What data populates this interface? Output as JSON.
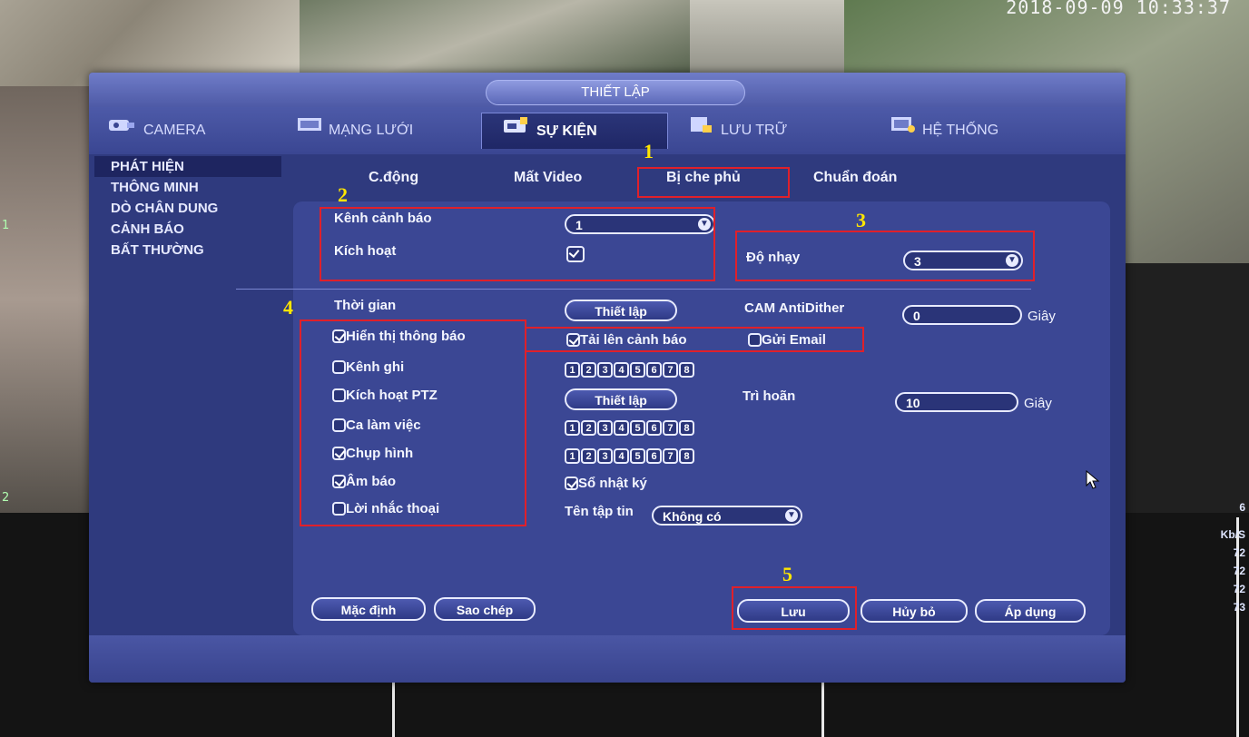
{
  "background": {
    "timestamp": "2018-09-09 10:33:37",
    "cam_labels": [
      "1",
      "2"
    ],
    "stats": [
      "6",
      "Kb/S",
      "72",
      "72",
      "72",
      "73"
    ]
  },
  "window": {
    "title": "THIẾT LẬP",
    "tabs": [
      {
        "label": "CAMERA",
        "icon": "camera-icon"
      },
      {
        "label": "MẠNG LƯỚI",
        "icon": "network-icon"
      },
      {
        "label": "SỰ KIỆN",
        "icon": "event-icon",
        "active": true
      },
      {
        "label": "LƯU TRỮ",
        "icon": "storage-icon"
      },
      {
        "label": "HỆ THỐNG",
        "icon": "system-icon"
      }
    ],
    "sidebar": [
      {
        "label": "PHÁT HIỆN",
        "active": true
      },
      {
        "label": "THÔNG MINH"
      },
      {
        "label": "DÒ CHÂN DUNG"
      },
      {
        "label": "CẢNH BÁO"
      },
      {
        "label": "BẤT THƯỜNG"
      }
    ],
    "subtabs": [
      "C.động",
      "Mất Video",
      "Bị che phủ",
      "Chuẩn đoán"
    ]
  },
  "form": {
    "alarm_channel_label": "Kênh cảnh báo",
    "alarm_channel_value": "1",
    "enable_label": "Kích hoạt",
    "sensitivity_label": "Độ nhạy",
    "sensitivity_value": "3",
    "time_label": "Thời gian",
    "setup_label": "Thiết lập",
    "cam_antidither_label": "CAM AntiDither",
    "cam_antidither_value": "0",
    "seconds_label": "Giây",
    "show_message_label": "Hiển thị thông báo",
    "upload_alarm_label": "Tải lên cảnh báo",
    "send_email_label": "Gửi Email",
    "record_channel_label": "Kênh ghi",
    "ptz_label": "Kích hoạt PTZ",
    "ptz_setup_label": "Thiết lập",
    "delay_label": "Trì hoãn",
    "delay_value": "10",
    "tour_label": "Ca làm việc",
    "snapshot_label": "Chụp hình",
    "buzzer_label": "Âm báo",
    "voice_prompt_label": "Lời nhắc thoại",
    "log_label": "Sổ nhật ký",
    "file_name_label": "Tên tập tin",
    "file_name_value": "Không có",
    "channel_numbers": [
      "1",
      "2",
      "3",
      "4",
      "5",
      "6",
      "7",
      "8"
    ]
  },
  "buttons": {
    "default": "Mặc định",
    "copy": "Sao chép",
    "save": "Lưu",
    "cancel": "Hủy bỏ",
    "apply": "Áp dụng"
  },
  "annotations": [
    "1",
    "2",
    "3",
    "4",
    "5"
  ],
  "colors": {
    "window_bg": "#2f3a7e",
    "highlight": "#e0202a",
    "annotation": "#ffe600"
  }
}
